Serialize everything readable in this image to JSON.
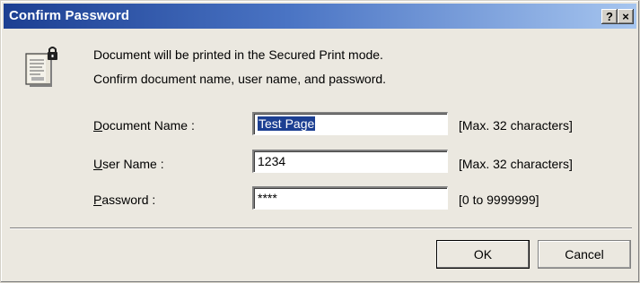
{
  "window": {
    "title": "Confirm Password",
    "help_glyph": "?",
    "close_glyph": "×"
  },
  "message": {
    "line1": "Document will be printed in the Secured Print mode.",
    "line2": "Confirm document name, user name, and password.",
    "icon": "secured-document-lock-icon"
  },
  "fields": {
    "document_name": {
      "label_access_key": "D",
      "label_rest": "ocument Name :",
      "value": "Test Page",
      "hint": "[Max. 32 characters]"
    },
    "user_name": {
      "label_access_key": "U",
      "label_rest": "ser Name :",
      "value": "1234",
      "hint": "[Max. 32 characters]"
    },
    "password": {
      "label_access_key": "P",
      "label_rest": "assword :",
      "value": "****",
      "hint": "[0 to 9999999]"
    }
  },
  "buttons": {
    "ok": "OK",
    "cancel": "Cancel"
  },
  "colors": {
    "title_start": "#1c3f92",
    "title_end": "#a6c5ef",
    "selection": "#1c3f92"
  }
}
